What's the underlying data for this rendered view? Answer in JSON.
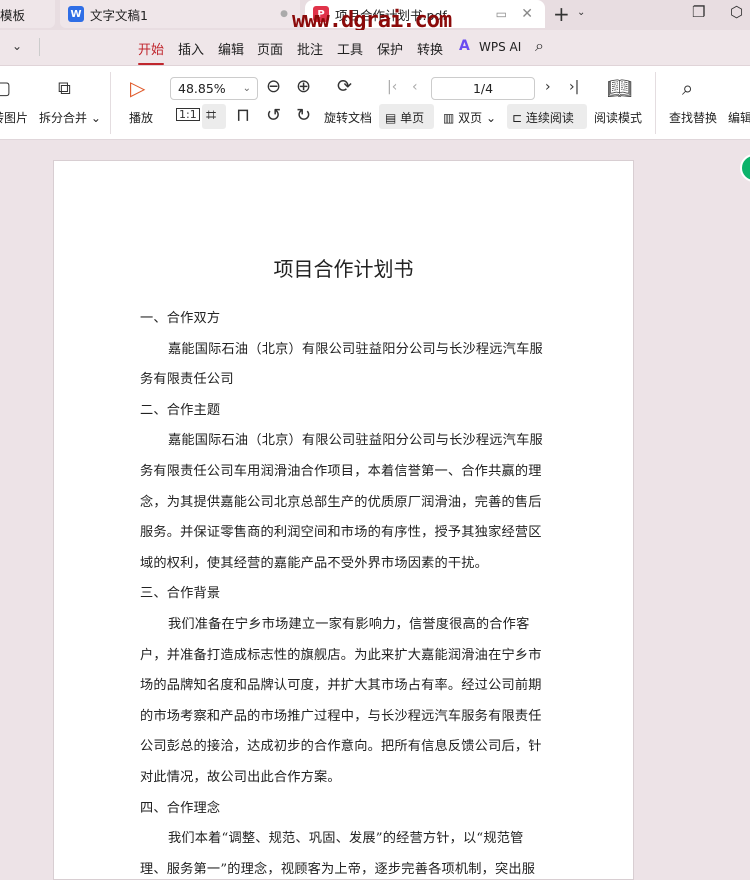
{
  "tabs": [
    {
      "label": "模板"
    },
    {
      "label": "文字文稿1",
      "icon": "W"
    },
    {
      "label": "项目合作计划书.pdf",
      "icon": "P"
    }
  ],
  "watermark": "www.dgrai.com",
  "menu": [
    "开始",
    "插入",
    "编辑",
    "页面",
    "批注",
    "工具",
    "保护",
    "转换",
    "WPS AI"
  ],
  "toolbar": {
    "to_image": "转图片",
    "split_merge": "拆分合并",
    "play": "播放",
    "zoom": "48.85%",
    "rotate": "旋转文档",
    "page": "1/4",
    "single": "单页",
    "double": "双页",
    "continuous": "连续阅读",
    "read_mode": "阅读模式",
    "find_replace": "查找替换",
    "edit": "编辑"
  },
  "document": {
    "title": "项目合作计划书",
    "lines": [
      {
        "text": "一、合作双方",
        "indent": false
      },
      {
        "text": "嘉能国际石油（北京）有限公司驻益阳分公司与长沙程远汽车服",
        "indent": true
      },
      {
        "text": "务有限责任公司",
        "indent": false
      },
      {
        "text": "二、合作主题",
        "indent": false
      },
      {
        "text": "嘉能国际石油（北京）有限公司驻益阳分公司与长沙程远汽车服",
        "indent": true
      },
      {
        "text": "务有限责任公司车用润滑油合作项目，本着信誉第一、合作共赢的理",
        "indent": false
      },
      {
        "text": "念，为其提供嘉能公司北京总部生产的优质原厂润滑油，完善的售后",
        "indent": false
      },
      {
        "text": "服务。并保证零售商的利润空间和市场的有序性，授予其独家经营区",
        "indent": false
      },
      {
        "text": "域的权利，使其经营的嘉能产品不受外界市场因素的干扰。",
        "indent": false
      },
      {
        "text": "三、合作背景",
        "indent": false
      },
      {
        "text": "我们准备在宁乡市场建立一家有影响力，信誉度很高的合作客",
        "indent": true
      },
      {
        "text": "户，并准备打造成标志性的旗舰店。为此来扩大嘉能润滑油在宁乡市",
        "indent": false
      },
      {
        "text": "场的品牌知名度和品牌认可度，并扩大其市场占有率。经过公司前期",
        "indent": false
      },
      {
        "text": "的市场考察和产品的市场推广过程中，与长沙程远汽车服务有限责任",
        "indent": false
      },
      {
        "text": "公司彭总的接洽，达成初步的合作意向。把所有信息反馈公司后，针",
        "indent": false
      },
      {
        "text": "对此情况，故公司出此合作方案。",
        "indent": false
      },
      {
        "text": "四、合作理念",
        "indent": false
      },
      {
        "text": "我们本着“调整、规范、巩固、发展”的经营方针，以“规范管",
        "indent": true
      },
      {
        "text": "理、服务第一”的理念，视顾客为上帝，逐步完善各项机制，突出服",
        "indent": false
      }
    ]
  }
}
